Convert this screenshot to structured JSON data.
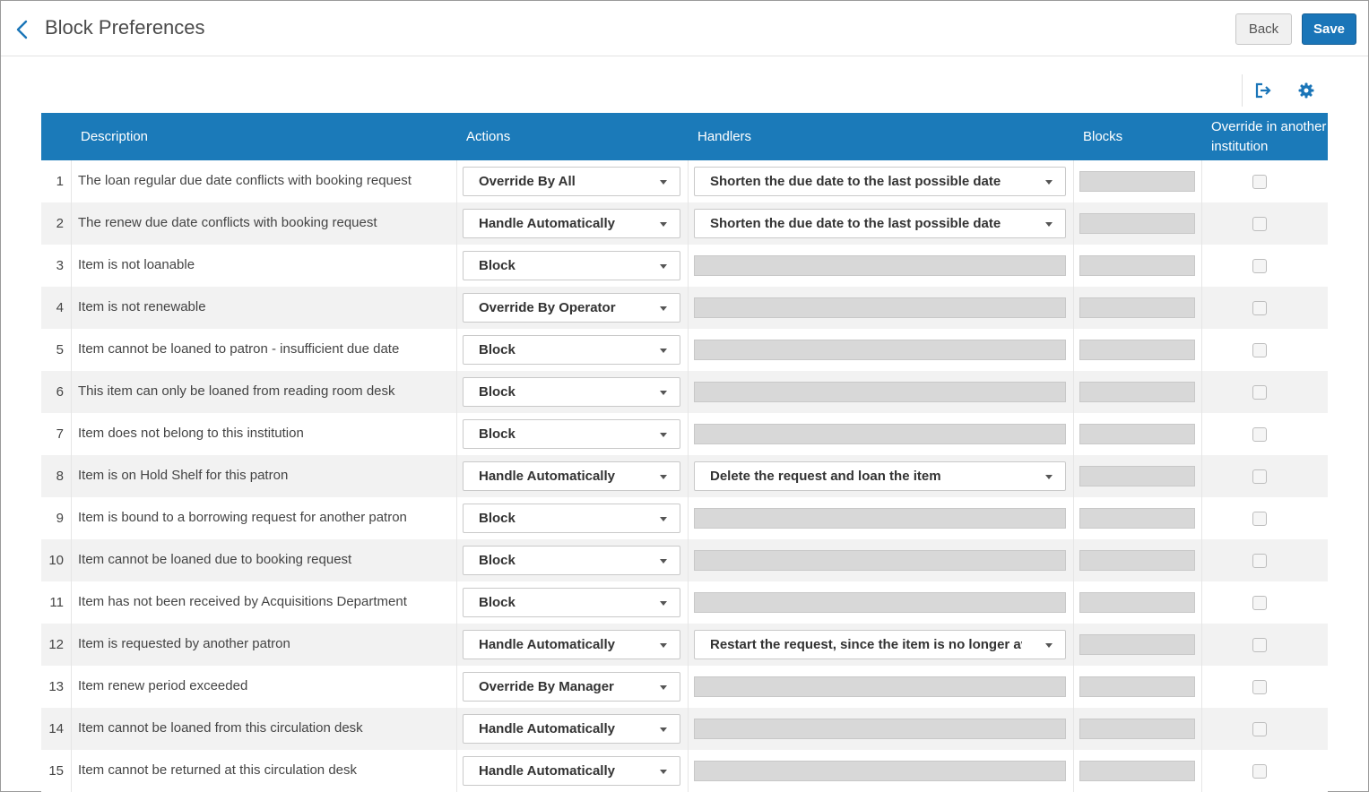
{
  "header": {
    "title": "Block Preferences",
    "back_label": "Back",
    "save_label": "Save"
  },
  "toolbar": {
    "icons": [
      "export-icon",
      "gear-icon"
    ]
  },
  "colors": {
    "accent": "#1b7ab9",
    "save_button": "#1a75b8"
  },
  "table": {
    "columns": {
      "description": "Description",
      "actions": "Actions",
      "handlers": "Handlers",
      "blocks": "Blocks",
      "override": "Override in another institution"
    },
    "rows": [
      {
        "num": "1",
        "description": "The loan regular due date conflicts with booking request",
        "action": "Override By All",
        "handler": "Shorten the due date to the last possible date",
        "override": false
      },
      {
        "num": "2",
        "description": "The renew due date conflicts with booking request",
        "action": "Handle Automatically",
        "handler": "Shorten the due date to the last possible date",
        "override": false
      },
      {
        "num": "3",
        "description": "Item is not loanable",
        "action": "Block",
        "handler": "",
        "override": false
      },
      {
        "num": "4",
        "description": "Item is not renewable",
        "action": "Override By Operator",
        "handler": "",
        "override": false
      },
      {
        "num": "5",
        "description": "Item cannot be loaned to patron - insufficient due date",
        "action": "Block",
        "handler": "",
        "override": false
      },
      {
        "num": "6",
        "description": "This item can only be loaned from reading room desk",
        "action": "Block",
        "handler": "",
        "override": false
      },
      {
        "num": "7",
        "description": "Item does not belong to this institution",
        "action": "Block",
        "handler": "",
        "override": false
      },
      {
        "num": "8",
        "description": "Item is on Hold Shelf for this patron",
        "action": "Handle Automatically",
        "handler": "Delete the request and loan the item",
        "override": false
      },
      {
        "num": "9",
        "description": "Item is bound to a borrowing request for another patron",
        "action": "Block",
        "handler": "",
        "override": false
      },
      {
        "num": "10",
        "description": "Item cannot be loaned due to booking request",
        "action": "Block",
        "handler": "",
        "override": false
      },
      {
        "num": "11",
        "description": "Item has not been received by Acquisitions Department",
        "action": "Block",
        "handler": "",
        "override": false
      },
      {
        "num": "12",
        "description": "Item is requested by another patron",
        "action": "Handle Automatically",
        "handler": "Restart the request, since the item is no longer ava",
        "override": false
      },
      {
        "num": "13",
        "description": "Item renew period exceeded",
        "action": "Override By Manager",
        "handler": "",
        "override": false
      },
      {
        "num": "14",
        "description": "Item cannot be loaned from this circulation desk",
        "action": "Handle Automatically",
        "handler": "",
        "override": false
      },
      {
        "num": "15",
        "description": "Item cannot be returned at this circulation desk",
        "action": "Handle Automatically",
        "handler": "",
        "override": false
      }
    ]
  }
}
